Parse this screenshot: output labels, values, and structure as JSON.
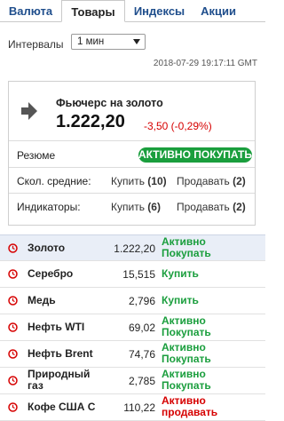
{
  "tabs": [
    {
      "label": "Валюта",
      "active": false
    },
    {
      "label": "Товары",
      "active": true
    },
    {
      "label": "Индексы",
      "active": false
    },
    {
      "label": "Акции",
      "active": false
    }
  ],
  "controls": {
    "interval_label": "Интервалы",
    "interval_value": "1 мин",
    "timestamp": "2018-07-29 19:17:11 GMT"
  },
  "featured": {
    "name": "Фьючерс на золото",
    "price": "1.222,20",
    "change": "-3,50 (-0,29%)",
    "summary_label": "Резюме",
    "summary_value": "АКТИВНО ПОКУПАТЬ",
    "ma_label": "Скол. средние:",
    "ma_buy_text": "Купить",
    "ma_buy_count": "(10)",
    "ma_sell_text": "Продавать",
    "ma_sell_count": "(2)",
    "ind_label": "Индикаторы:",
    "ind_buy_text": "Купить",
    "ind_buy_count": "(6)",
    "ind_sell_text": "Продавать",
    "ind_sell_count": "(2)"
  },
  "colors": {
    "buy": "#1a9e3d",
    "sell": "#d60000",
    "tab_link": "#1f4e8c",
    "selected_row": "#e9eef7"
  },
  "commodities": [
    {
      "name": "Золото",
      "value": "1.222,20",
      "signal": "Активно Покупать",
      "signal_type": "buy"
    },
    {
      "name": "Серебро",
      "value": "15,515",
      "signal": "Купить",
      "signal_type": "buy"
    },
    {
      "name": "Медь",
      "value": "2,796",
      "signal": "Купить",
      "signal_type": "buy"
    },
    {
      "name": "Нефть WTI",
      "value": "69,02",
      "signal": "Активно Покупать",
      "signal_type": "buy"
    },
    {
      "name": "Нефть Brent",
      "value": "74,76",
      "signal": "Активно Покупать",
      "signal_type": "buy"
    },
    {
      "name": "Природный газ",
      "value": "2,785",
      "signal": "Активно Покупать",
      "signal_type": "buy"
    },
    {
      "name": "Кофе США С",
      "value": "110,22",
      "signal": "Активно продавать",
      "signal_type": "sell"
    }
  ],
  "icons": {
    "trend": "arrow-right-icon",
    "row": "clock-icon"
  }
}
